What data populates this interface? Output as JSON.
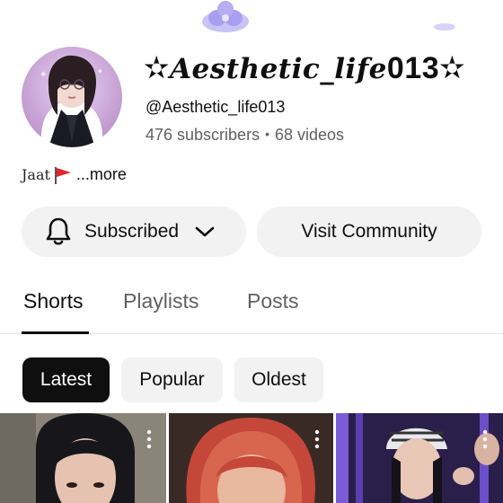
{
  "channel": {
    "title_prefix_star": "✫",
    "title_script": "Aesthetic_life",
    "title_digits": "013",
    "title_suffix_star": "✫",
    "handle": "@Aesthetic_life013",
    "subscribers": "476 subscribers",
    "separator": "•",
    "videos": "68 videos"
  },
  "description": {
    "text": "Jaat",
    "flag_icon": "red-flag-icon",
    "more": "...more"
  },
  "actions": {
    "subscribed_label": "Subscribed",
    "community_label": "Visit Community"
  },
  "tabs": [
    {
      "label": "Shorts",
      "active": true
    },
    {
      "label": "Playlists",
      "active": false
    },
    {
      "label": "Posts",
      "active": false
    }
  ],
  "filters": [
    {
      "label": "Latest",
      "selected": true
    },
    {
      "label": "Popular",
      "selected": false
    },
    {
      "label": "Oldest",
      "selected": false
    }
  ],
  "colors": {
    "text_primary": "#0f0f0f",
    "text_secondary": "#606060",
    "button_bg": "#f2f2f2",
    "chip_selected_bg": "#0f0f0f",
    "banner_accent": "#b9b0f0"
  }
}
